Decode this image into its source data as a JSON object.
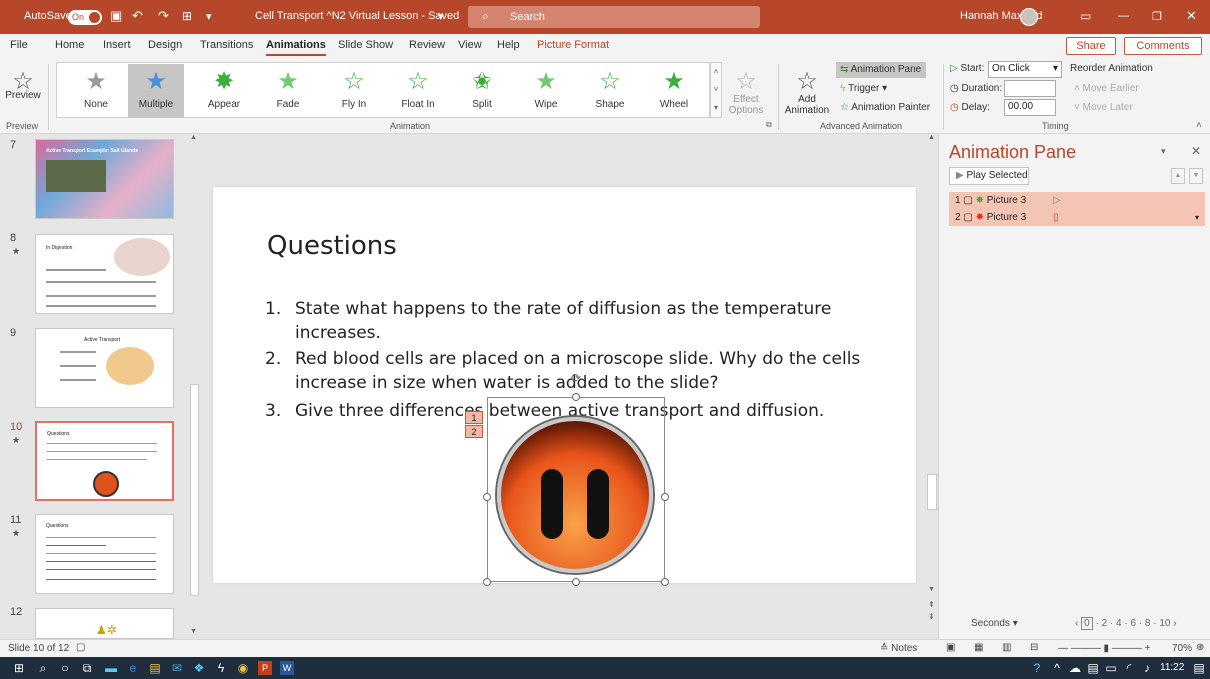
{
  "titlebar": {
    "autosave": "AutoSave",
    "autosave_state": "On",
    "doc_title": "Cell Transport ^N2 Virtual Lesson - Saved",
    "search": "Search",
    "user": "Hannah Maxfield"
  },
  "tabs": [
    "File",
    "Home",
    "Insert",
    "Design",
    "Transitions",
    "Animations",
    "Slide Show",
    "Review",
    "View",
    "Help",
    "Picture Format"
  ],
  "share": "Share",
  "comments": "Comments",
  "ribbon": {
    "preview": "Preview",
    "effects": [
      "None",
      "Multiple",
      "Appear",
      "Fade",
      "Fly In",
      "Float In",
      "Split",
      "Wipe",
      "Shape",
      "Wheel"
    ],
    "effect_options": "Effect Options",
    "add_animation": "Add Animation",
    "animation_pane": "Animation Pane",
    "trigger": "Trigger",
    "animation_painter": "Animation Painter",
    "start_label": "Start:",
    "start_value": "On Click",
    "duration_label": "Duration:",
    "delay_label": "Delay:",
    "delay_value": "00.00",
    "reorder": "Reorder Animation",
    "move_earlier": "Move Earlier",
    "move_later": "Move Later",
    "groups": {
      "preview": "Preview",
      "animation": "Animation",
      "advanced": "Advanced Animation",
      "timing": "Timing"
    }
  },
  "thumbs": [
    {
      "num": "7",
      "title": "Active Transport Example: Salt Glands"
    },
    {
      "num": "8",
      "title": "In Digestion"
    },
    {
      "num": "9",
      "title": "Active Transport"
    },
    {
      "num": "10",
      "title": "Questions"
    },
    {
      "num": "11",
      "title": "Questions"
    },
    {
      "num": "12",
      "title": ""
    }
  ],
  "slide": {
    "title": "Questions",
    "questions": [
      {
        "n": "1.",
        "text": "State what happens to the rate of diffusion as the temperature increases."
      },
      {
        "n": "2.",
        "text": "Red blood cells are placed on a microscope slide. Why do the cells increase in size when water is added to the slide?"
      },
      {
        "n": "3.",
        "text": "Give three differences between active transport and diffusion."
      }
    ],
    "tags": [
      "1",
      "2"
    ]
  },
  "pane": {
    "title": "Animation Pane",
    "play_selected": "Play Selected",
    "items": [
      {
        "num": "1",
        "name": "Picture 3"
      },
      {
        "num": "2",
        "name": "Picture 3"
      }
    ],
    "seconds": "Seconds",
    "scale": [
      "0",
      "2",
      "4",
      "6",
      "8",
      "10"
    ]
  },
  "status": {
    "slide": "Slide 10 of 12",
    "notes": "Notes",
    "zoom": "70%",
    "time": "11:22"
  }
}
